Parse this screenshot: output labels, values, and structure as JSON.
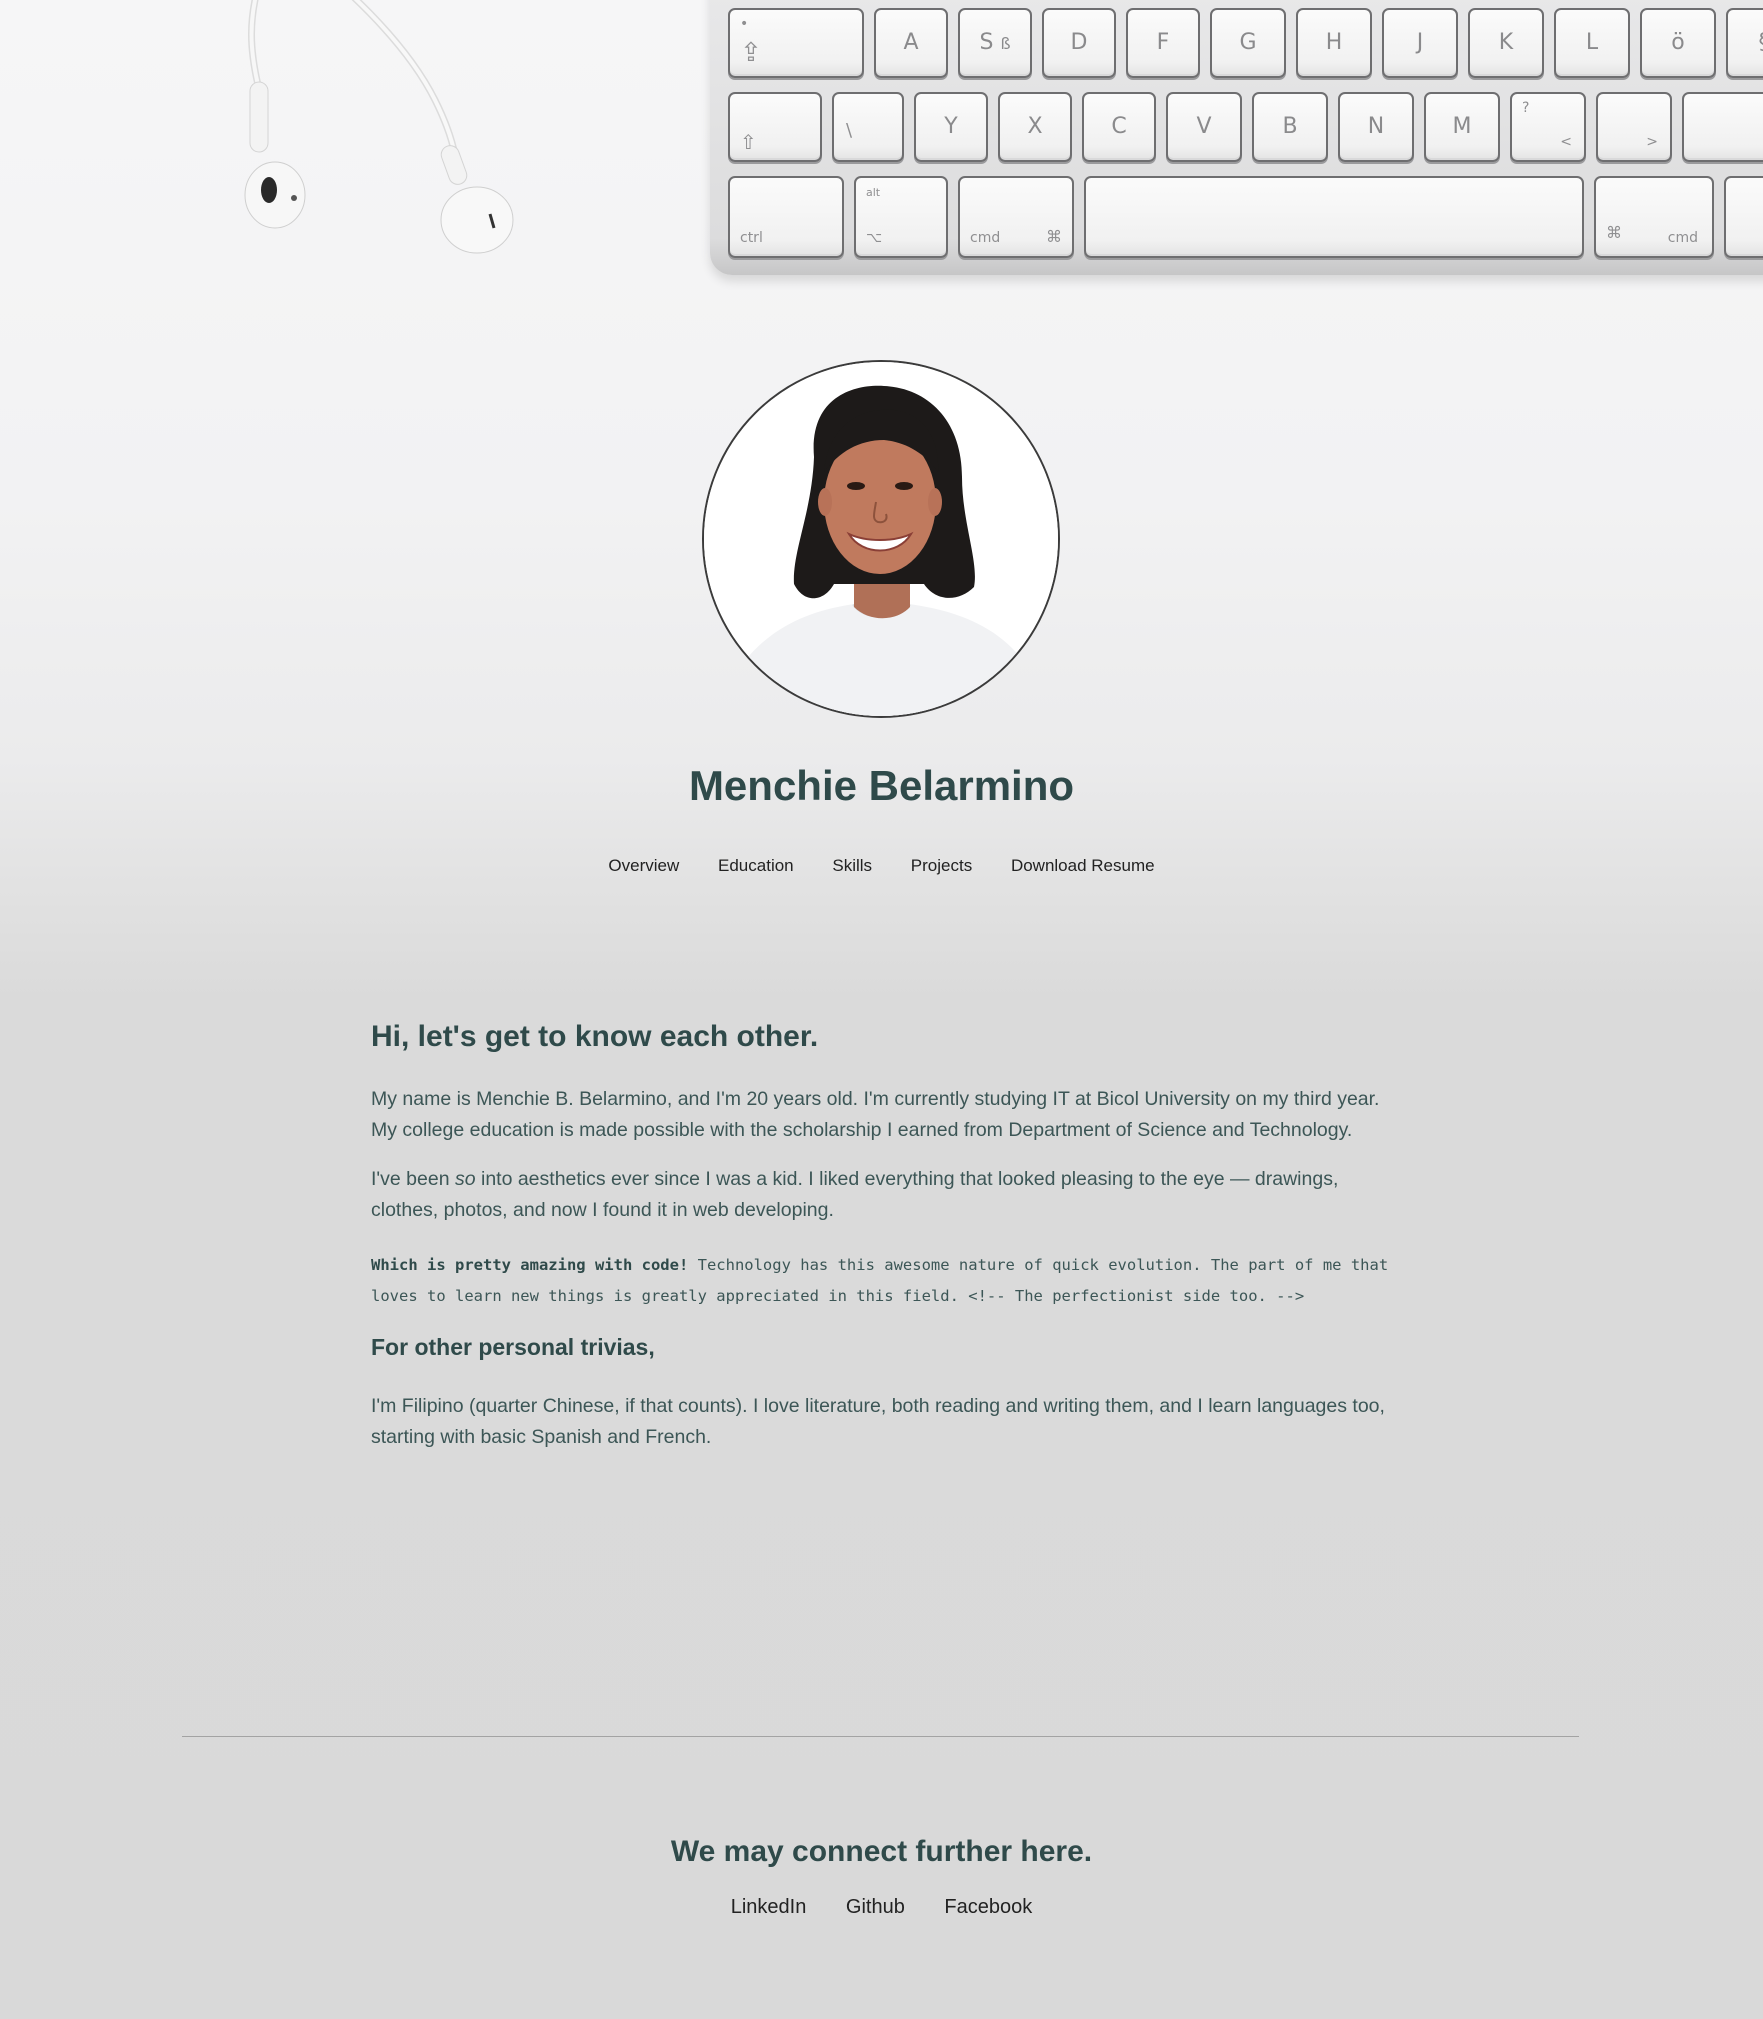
{
  "profile": {
    "name": "Menchie Belarmino"
  },
  "nav": {
    "items": [
      "Overview",
      "Education",
      "Skills",
      "Projects",
      "Download Resume"
    ]
  },
  "keyboard": {
    "row1": [
      "A",
      "S",
      "D",
      "F",
      "G",
      "H",
      "J",
      "K",
      "L"
    ],
    "row2": [
      "Y",
      "X",
      "C",
      "V",
      "B",
      "N",
      "M"
    ],
    "row3_labels": [
      "ctrl",
      "alt",
      "cmd",
      "⌘",
      "cmd"
    ],
    "extra_glyphs": [
      "ß",
      "ö",
      "§",
      "?",
      "<",
      ">",
      "\\",
      "⇧",
      "⌥"
    ]
  },
  "about": {
    "heading": "Hi, let's get to know each other.",
    "p1": "My name is Menchie B. Belarmino, and I'm 20 years old. I'm currently studying IT at Bicol University on my third year. My college education is made possible with the scholarship I earned from Department of Science and Technology.",
    "p2_before": "I've been ",
    "p2_emphasis": "so",
    "p2_after": " into aesthetics ever since I was a kid. I liked everything that looked pleasing to the eye — drawings, clothes, photos, and now I found it in web developing.",
    "code_bold": "Which is pretty amazing with code!",
    "code_text": " Technology has this awesome nature of quick evolution. The part of me that loves to learn new things is greatly appreciated in this field. <!-- The perfectionist side too. -->",
    "subheading": "For other personal trivias,",
    "p3": "I'm Filipino (quarter Chinese, if that counts). I love literature, both reading and writing them, and I learn languages too, starting with basic Spanish and French."
  },
  "footer": {
    "heading": "We may connect further here.",
    "links": [
      "LinkedIn",
      "Github",
      "Facebook"
    ]
  }
}
